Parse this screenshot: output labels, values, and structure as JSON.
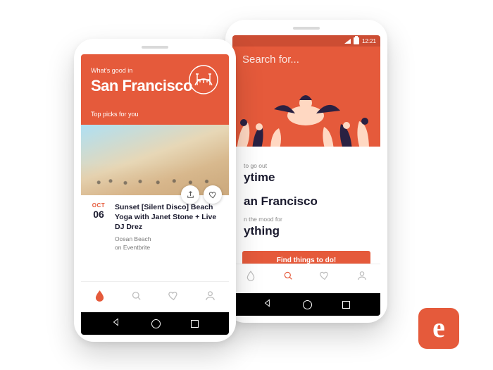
{
  "brand": {
    "accent": "#e55a3b",
    "logo_letter": "e"
  },
  "left_phone": {
    "hero": {
      "subtitle": "What's good in",
      "city": "San Francisco",
      "picks_label": "Top picks for you",
      "icon_name": "golden-gate-icon"
    },
    "event": {
      "month": "OCT",
      "day": "06",
      "title": "Sunset [Silent Disco] Beach Yoga with Janet Stone + Live DJ Drez",
      "venue": "Ocean Beach",
      "source": "on Eventbrite",
      "actions": {
        "share": "share-icon",
        "favorite": "heart-icon"
      }
    },
    "tabs": [
      "home-icon",
      "search-icon",
      "heart-icon",
      "profile-icon"
    ],
    "active_tab_index": 0
  },
  "right_phone": {
    "status": {
      "time": "12:21"
    },
    "search_placeholder": "Search for...",
    "filters": {
      "when_label": "to go out",
      "when_value": "ytime",
      "where_value": "an Francisco",
      "mood_label": "n the mood for",
      "mood_value": "ything"
    },
    "cta": "Find things to do!",
    "tabs": [
      "home-icon",
      "search-icon",
      "heart-icon",
      "profile-icon"
    ],
    "active_tab_index": 1
  }
}
